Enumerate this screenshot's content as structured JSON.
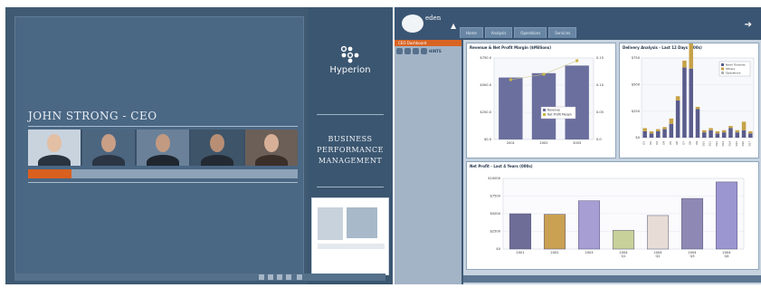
{
  "presentation": {
    "speaker": "JOHN STRONG - CEO",
    "progress_fraction": 0.16,
    "photos": [
      {
        "name": "photo-ceo",
        "bg": "#c8d3de",
        "skin": "#e3bfa4",
        "suit": "#2a3340"
      },
      {
        "name": "photo-woman-1",
        "bg": "#4d6680",
        "skin": "#c99f86",
        "suit": "#2b3544"
      },
      {
        "name": "photo-man-2",
        "bg": "#6a8199",
        "skin": "#c29a81",
        "suit": "#1f2630"
      },
      {
        "name": "photo-man-3",
        "bg": "#3e5468",
        "skin": "#b88f75",
        "suit": "#232a33"
      },
      {
        "name": "photo-woman-2",
        "bg": "#6b5f58",
        "skin": "#d7b097",
        "suit": "#3b2f2a"
      }
    ],
    "brand": "Hyperion",
    "tagline_lines": [
      "BUSINESS",
      "PERFORMANCE",
      "MANAGEMENT"
    ]
  },
  "dashboard": {
    "brand": "eden",
    "tabs": [
      {
        "label": "Home",
        "active": true
      },
      {
        "label": "Analysis",
        "active": false
      },
      {
        "label": "Operations",
        "active": false
      },
      {
        "label": "Services",
        "active": false
      }
    ],
    "side_title": "CEO Dashboard",
    "hints_label": "HINTS"
  },
  "chart_data": [
    {
      "type": "bar",
      "title": "Revenue & Net Profit Margin ($Millions)",
      "categories": [
        "2001",
        "2002",
        "2003"
      ],
      "series": [
        {
          "name": "Revenue",
          "values": [
            570,
            610,
            680
          ]
        },
        {
          "name": "Net Profit Margin",
          "type": "line",
          "values": [
            0.11,
            0.12,
            0.145
          ]
        }
      ],
      "y_ticks": [
        "$0.0",
        "$250.0",
        "$500.0",
        "$750.0"
      ],
      "y2_ticks": [
        "0.0",
        "0.05",
        "0.10",
        "0.15"
      ],
      "ylim": [
        0,
        750
      ],
      "y2lim": [
        0,
        0.15
      ],
      "colors": [
        "#6b6f9e",
        "#c9b445"
      ],
      "legend": "bottom-right"
    },
    {
      "type": "bar",
      "title": "Delivery Analysis - Last 12 Days (000s)",
      "categories": [
        "D1",
        "D2",
        "D3",
        "D4",
        "D5",
        "D6",
        "D7",
        "D8",
        "D9",
        "D10",
        "D11",
        "D12",
        "D13",
        "D14",
        "D15",
        "D16",
        "D17"
      ],
      "series": [
        {
          "name": "Nadir Turbines",
          "values": [
            120,
            80,
            120,
            160,
            260,
            700,
            1320,
            1300,
            540,
            100,
            140,
            80,
            100,
            180,
            100,
            140,
            80
          ]
        },
        {
          "name": "Others",
          "values": [
            60,
            40,
            40,
            40,
            100,
            80,
            130,
            900,
            40,
            40,
            40,
            40,
            40,
            40,
            40,
            160,
            40
          ]
        },
        {
          "name": "Operations",
          "values": [
            0,
            0,
            0,
            0,
            0,
            0,
            0,
            0,
            0,
            0,
            0,
            0,
            0,
            0,
            0,
            0,
            0
          ]
        }
      ],
      "y_ticks": [
        "$0",
        "$250",
        "$500",
        "$750"
      ],
      "ylim": [
        0,
        1500
      ],
      "colors": [
        "#5a5c8c",
        "#c6a248",
        "#b4b4b4"
      ],
      "legend": "top-right"
    },
    {
      "type": "bar",
      "title": "Net Profit - Last 4 Years (000s)",
      "categories": [
        "2001",
        "2002",
        "2003",
        "2004",
        "2004 Q1",
        "2004 Q2",
        "2004 Q3",
        "2004 Q4"
      ],
      "values": [
        6000,
        5900,
        8200,
        3200,
        5700,
        8600,
        11400
      ],
      "labels": [
        "2001",
        "2002",
        "2003",
        "2004 Q1",
        "2004 Q2",
        "2004 Q3",
        "2004 Q4"
      ],
      "y_ticks": [
        "$0",
        "$2500",
        "$5000",
        "$7500",
        "$10000"
      ],
      "ylim": [
        0,
        12000
      ],
      "bar_colors": [
        "#6e6d98",
        "#caa052",
        "#a79ed4",
        "#c8d19a",
        "#e8ddd6",
        "#8e89b4",
        "#9c96d0"
      ]
    }
  ]
}
